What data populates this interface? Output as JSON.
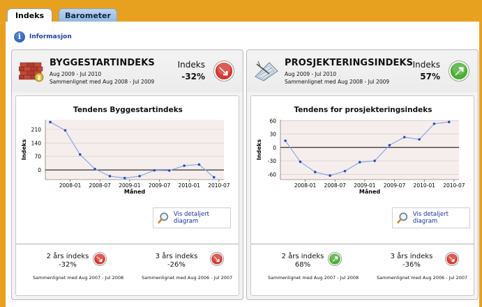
{
  "tabs": [
    {
      "label": "Indeks",
      "active": true
    },
    {
      "label": "Barometer",
      "active": false
    }
  ],
  "info_link": "Informasjon",
  "colors": {
    "frame": "#e8a11f",
    "line": "#8da9e2",
    "point": "#2550b3",
    "plot_bg": "#f6eded",
    "down_arrow": "#d53a2f",
    "up_arrow": "#4cae36",
    "link": "#1d2fa0"
  },
  "panels": [
    {
      "icon": "brick-wall-icon",
      "title": "BYGGESTARTINDEKS",
      "period": "Aug 2009 - Jul 2010",
      "compare": "Sammenlignet med Aug 2008 - Jul 2009",
      "index_label": "Indeks",
      "index_value": "-32%",
      "index_direction": "down",
      "chart_title": "Tendens Byggestartindeks",
      "detail_button": "Vis detaljert diagram",
      "stats": [
        {
          "label": "2 års indeks",
          "value": "-32%",
          "direction": "down",
          "compare": "Sammenlignet med Aug 2007 - Jul 2008"
        },
        {
          "label": "3 års indeks",
          "value": "-26%",
          "direction": "down",
          "compare": "Sammenlignet med Aug 2006 - Jul 2007"
        }
      ]
    },
    {
      "icon": "blueprint-icon",
      "title": "PROSJEKTERINGSINDEKS",
      "period": "Aug 2009 - Jul 2010",
      "compare": "Sammenlignet med Aug 2008 - Jul 2009",
      "index_label": "Indeks",
      "index_value": "57%",
      "index_direction": "up",
      "chart_title": "Tendens for prosjekteringsindeks",
      "detail_button": "Vis detaljert diagram",
      "stats": [
        {
          "label": "2 års indeks",
          "value": "68%",
          "direction": "up",
          "compare": "Sammenlignet med Aug 2007 - Jul 2008"
        },
        {
          "label": "3 års indeks",
          "value": "-36%",
          "direction": "down",
          "compare": "Sammenlignet med Aug 2006 - Jul 2007"
        }
      ]
    }
  ],
  "chart_data": [
    {
      "type": "line",
      "title": "Tendens Byggestartindeks",
      "xlabel": "Måned",
      "ylabel": "Indeks",
      "x": [
        "2007-09",
        "2007-12",
        "2008-03",
        "2008-06",
        "2008-09",
        "2008-12",
        "2009-03",
        "2009-06",
        "2009-09",
        "2009-12",
        "2010-03",
        "2010-06"
      ],
      "values": [
        248,
        205,
        80,
        5,
        -32,
        -42,
        -32,
        -2,
        -3,
        22,
        28,
        -38
      ],
      "xticks": [
        "2008-01",
        "2008-07",
        "2009-01",
        "2009-07",
        "2010-01",
        "2010-07"
      ],
      "yticks": [
        0,
        70,
        140,
        210
      ],
      "ylim": [
        -50,
        260
      ],
      "grid": true,
      "zero_line": true
    },
    {
      "type": "line",
      "title": "Tendens for prosjekteringsindeks",
      "xlabel": "Måned",
      "ylabel": "Indeks",
      "x": [
        "2007-09",
        "2007-12",
        "2008-03",
        "2008-06",
        "2008-09",
        "2008-12",
        "2009-03",
        "2009-06",
        "2009-09",
        "2009-12",
        "2010-03",
        "2010-06"
      ],
      "values": [
        15,
        -32,
        -55,
        -63,
        -53,
        -33,
        -30,
        5,
        23,
        18,
        53,
        57
      ],
      "xticks": [
        "2008-01",
        "2008-07",
        "2009-01",
        "2009-07",
        "2010-01",
        "2010-07"
      ],
      "yticks": [
        -60,
        -30,
        0,
        30,
        60
      ],
      "ylim": [
        -72,
        62
      ],
      "grid": true,
      "zero_line": true
    }
  ]
}
